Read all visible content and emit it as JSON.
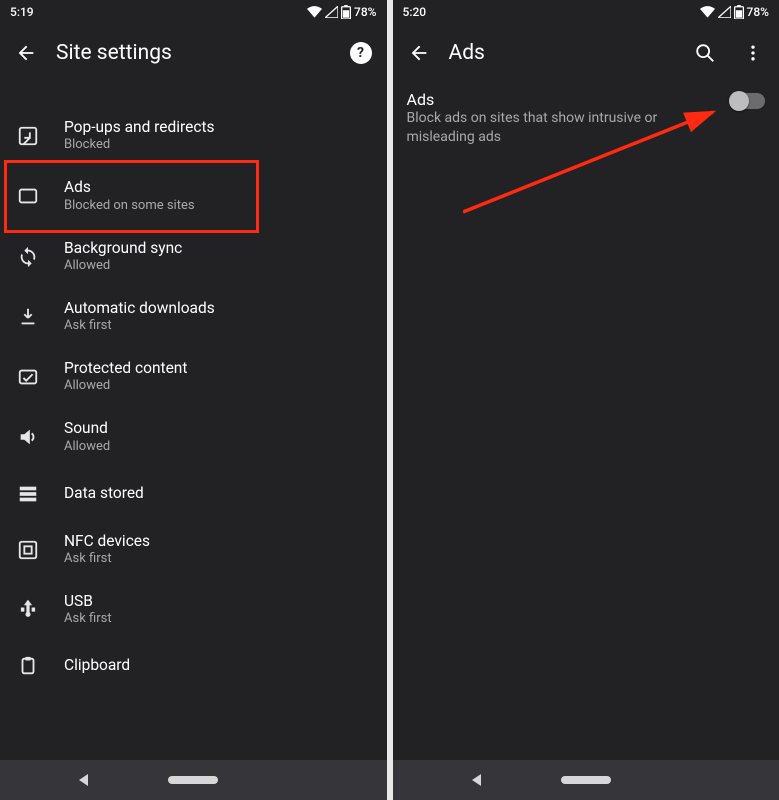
{
  "left": {
    "status": {
      "time": "5:19",
      "battery": "78%"
    },
    "title": "Site settings",
    "items": [
      {
        "icon": "popup",
        "label": "Pop-ups and redirects",
        "sub": "Blocked"
      },
      {
        "icon": "ads",
        "label": "Ads",
        "sub": "Blocked on some sites"
      },
      {
        "icon": "sync",
        "label": "Background sync",
        "sub": "Allowed"
      },
      {
        "icon": "download",
        "label": "Automatic downloads",
        "sub": "Ask first"
      },
      {
        "icon": "protected",
        "label": "Protected content",
        "sub": "Allowed"
      },
      {
        "icon": "sound",
        "label": "Sound",
        "sub": "Allowed"
      },
      {
        "icon": "storage",
        "label": "Data stored",
        "sub": ""
      },
      {
        "icon": "nfc",
        "label": "NFC devices",
        "sub": "Ask first"
      },
      {
        "icon": "usb",
        "label": "USB",
        "sub": "Ask first"
      },
      {
        "icon": "clipboard",
        "label": "Clipboard",
        "sub": ""
      }
    ],
    "highlight_item_index": 1
  },
  "right": {
    "status": {
      "time": "5:20",
      "battery": "78%"
    },
    "title": "Ads",
    "ads": {
      "label": "Ads",
      "sub": "Block ads on sites that show intrusive or misleading ads",
      "toggle_on": false
    }
  },
  "annotation": {
    "color": "#ff2a12"
  }
}
